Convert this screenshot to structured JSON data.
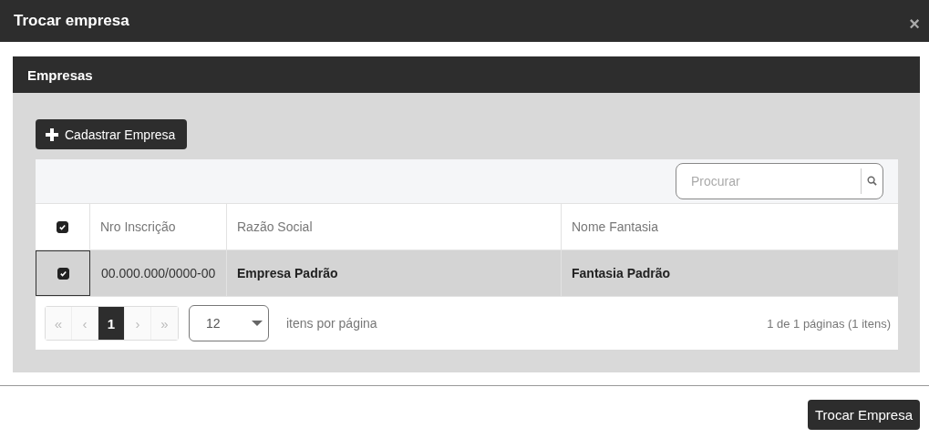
{
  "window": {
    "title": "Trocar empresa",
    "close": "×"
  },
  "panel": {
    "title": "Empresas"
  },
  "add_button": {
    "label": "Cadastrar Empresa"
  },
  "search": {
    "placeholder": "Procurar"
  },
  "table": {
    "header_checked": true,
    "columns": [
      "Nro Inscrição",
      "Razão Social",
      "Nome Fantasia"
    ],
    "rows": [
      {
        "checked": true,
        "selected": true,
        "cells": [
          "00.000.000/0000-00",
          "Empresa Padrão",
          "Fantasia Padrão"
        ]
      }
    ]
  },
  "pager": {
    "buttons": [
      {
        "label": "«",
        "kind": "nav",
        "disabled": true
      },
      {
        "label": "‹",
        "kind": "nav",
        "disabled": true
      },
      {
        "label": "1",
        "kind": "page",
        "selected": true
      },
      {
        "label": "›",
        "kind": "nav",
        "disabled": true
      },
      {
        "label": "»",
        "kind": "nav",
        "disabled": true
      }
    ],
    "page_size": "12",
    "page_size_label": "itens por página",
    "summary": "1 de 1 páginas (1 itens)"
  },
  "footer": {
    "button": "Trocar Empresa"
  }
}
